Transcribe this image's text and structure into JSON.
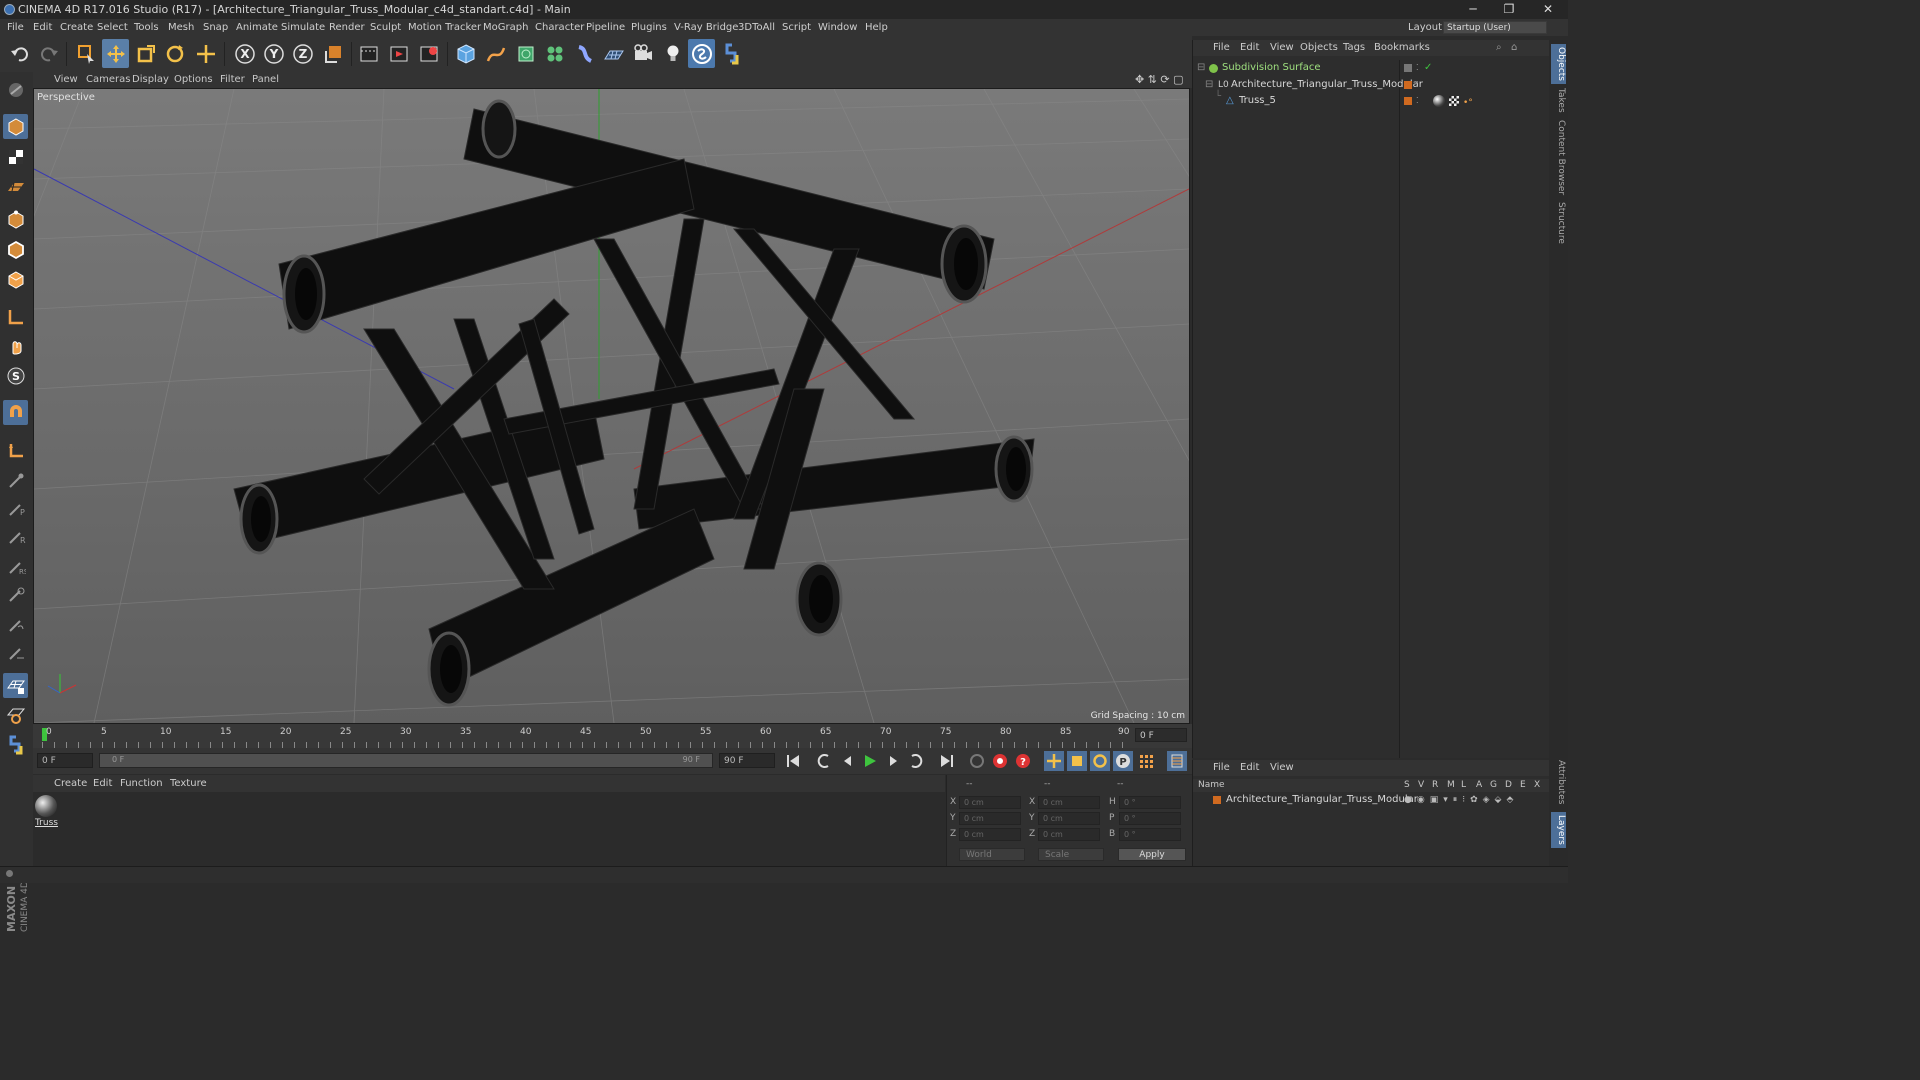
{
  "window": {
    "title": "CINEMA 4D R17.016 Studio (R17) - [Architecture_Triangular_Truss_Modular_c4d_standart.c4d] - Main",
    "minimize": "─",
    "maximize": "❐",
    "close": "✕"
  },
  "menubar": {
    "items": [
      "File",
      "Edit",
      "Create",
      "Select",
      "Tools",
      "Mesh",
      "Snap",
      "Animate",
      "Simulate",
      "Render",
      "Sculpt",
      "Motion Tracker",
      "MoGraph",
      "Character",
      "Pipeline",
      "Plugins",
      "V-Ray Bridge",
      "3DToAll",
      "Script",
      "Window",
      "Help"
    ],
    "layout_label": "Layout:",
    "layout_value": "Startup (User)"
  },
  "toolbar": {
    "icons": [
      "undo-icon",
      "redo-icon",
      "live-selection-icon",
      "move-icon",
      "scale-icon",
      "rotate-icon",
      "transform-icon",
      "x-axis-icon",
      "y-axis-icon",
      "z-axis-icon",
      "coordinate-system-icon",
      "render-view-icon",
      "render-picture-viewer-icon",
      "render-settings-icon",
      "cube-icon",
      "pen-spline-icon",
      "subdivision-icon",
      "cloner-icon",
      "deformer-icon",
      "floor-icon",
      "camera-icon",
      "light-icon",
      "scene-icon",
      "python-icon"
    ],
    "axis_x": "X",
    "axis_y": "Y",
    "axis_z": "Z"
  },
  "left_tools": {
    "icons": [
      "make-editable-icon",
      "model-mode-icon",
      "texture-mode-icon",
      "workplane-mode-icon",
      "points-mode-icon",
      "edges-mode-icon",
      "polygons-mode-icon",
      "enable-axis-icon",
      "tweak-icon",
      "snap-icon",
      "magnet-icon",
      "axis-icon",
      "brush-tool-icon",
      "sculpt-icon",
      "knife-icon",
      "extrude-icon",
      "bevel-icon",
      "bridge-icon",
      "grid-lock-icon",
      "workplane-icon",
      "python-icon"
    ]
  },
  "viewport": {
    "menu": [
      "View",
      "Cameras",
      "Display",
      "Options",
      "Filter",
      "Panel"
    ],
    "label": "Perspective",
    "grid_spacing": "Grid Spacing : 10 cm"
  },
  "timeline": {
    "ticks": [
      "0",
      "5",
      "10",
      "15",
      "20",
      "25",
      "30",
      "35",
      "40",
      "45",
      "50",
      "55",
      "60",
      "65",
      "70",
      "75",
      "80",
      "85",
      "90"
    ],
    "current_frame": "0 F"
  },
  "transport": {
    "start_field": "0 F",
    "range_start": "0 F",
    "range_end": "90 F",
    "end_field": "90 F"
  },
  "material_manager": {
    "menu": [
      "Create",
      "Edit",
      "Function",
      "Texture"
    ],
    "materials": [
      {
        "name": "Truss"
      }
    ]
  },
  "coordinates": {
    "header_a": "--",
    "header_b": "--",
    "header_c": "--",
    "pos": [
      {
        "axis": "X",
        "value": "0 cm"
      },
      {
        "axis": "Y",
        "value": "0 cm"
      },
      {
        "axis": "Z",
        "value": "0 cm"
      }
    ],
    "size": [
      {
        "axis": "X",
        "value": "0 cm"
      },
      {
        "axis": "Y",
        "value": "0 cm"
      },
      {
        "axis": "Z",
        "value": "0 cm"
      }
    ],
    "rot": [
      {
        "axis": "H",
        "value": "0 °"
      },
      {
        "axis": "P",
        "value": "0 °"
      },
      {
        "axis": "B",
        "value": "0 °"
      }
    ],
    "space": "World",
    "mode": "Scale",
    "apply": "Apply"
  },
  "object_manager": {
    "menu": [
      "File",
      "Edit",
      "View",
      "Objects",
      "Tags",
      "Bookmarks"
    ],
    "objects": [
      {
        "name": "Subdivision Surface",
        "color": "#7fc24a"
      },
      {
        "name": "Architecture_Triangular_Truss_Modular",
        "color": "#cfcfcf"
      },
      {
        "name": "Truss_5",
        "color": "#5aa0e0"
      }
    ]
  },
  "attribute_manager": {
    "menu": [
      "File",
      "Edit",
      "View"
    ],
    "columns": [
      "Name",
      "S",
      "V",
      "R",
      "M",
      "L",
      "A",
      "G",
      "D",
      "E",
      "X"
    ],
    "rows": [
      {
        "name": "Architecture_Triangular_Truss_Modular"
      }
    ]
  },
  "side_tabs": [
    "Objects",
    "Takes",
    "Content Browser",
    "Structure",
    "Attributes",
    "Layers"
  ],
  "brand": {
    "line1": "MAXON",
    "line2": "CINEMA 4D"
  },
  "colors": {
    "accent_blue": "#4a7fc1",
    "orange_tag": "#d06a20",
    "play_green": "#3ec43e",
    "record_red": "#d33"
  }
}
